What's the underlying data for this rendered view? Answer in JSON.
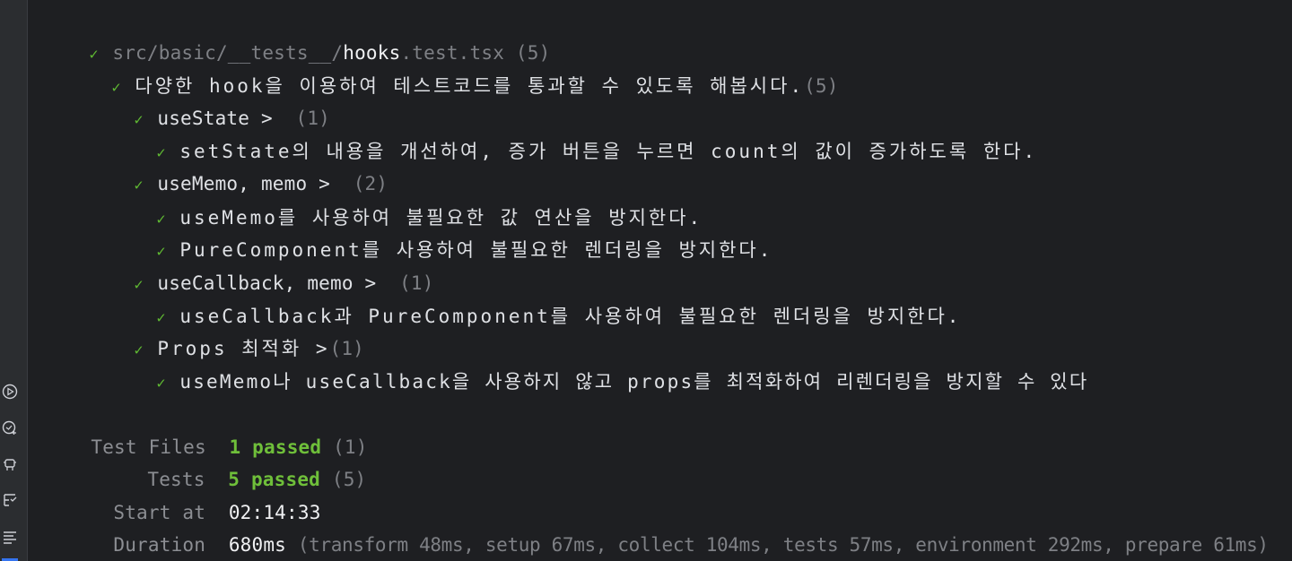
{
  "file": {
    "path_prefix": "src/basic/__tests__/",
    "name": "hooks",
    "ext": ".test.tsx",
    "count": "(5)"
  },
  "suite": {
    "title": "다양한 hook을 이용하여 테스트코드를 통과할 수 있도록 해봅시다.",
    "count": "(5)"
  },
  "groups": [
    {
      "title": "useState >",
      "count": "(1)",
      "tests": [
        "setState의 내용을 개선하여, 증가 버튼을 누르면 count의 값이 증가하도록 한다."
      ]
    },
    {
      "title": "useMemo, memo >",
      "count": "(2)",
      "tests": [
        "useMemo를 사용하여 불필요한 값 연산을 방지한다.",
        "PureComponent를 사용하여 불필요한 렌더링을 방지한다."
      ]
    },
    {
      "title": "useCallback, memo >",
      "count": "(1)",
      "tests": [
        "useCallback과 PureComponent를 사용하여 불필요한 렌더링을 방지한다."
      ]
    },
    {
      "title": "Props 최적화 >",
      "count": "(1)",
      "tests": [
        "useMemo나 useCallback을 사용하지 않고 props를 최적화하여 리렌더링을 방지할 수 있다"
      ]
    }
  ],
  "summary": {
    "test_files_label": "Test Files",
    "test_files_value": "1 passed",
    "test_files_count": "(1)",
    "tests_label": "Tests",
    "tests_value": "5 passed",
    "tests_count": "(5)",
    "start_label": "Start at",
    "start_value": "02:14:33",
    "duration_label": "Duration",
    "duration_value": "680ms",
    "duration_detail": "(transform 48ms, setup 67ms, collect 104ms, tests 57ms, environment 292ms, prepare 61ms)"
  },
  "gutter_icons": [
    "run-icon",
    "coverage-icon",
    "debug-icon",
    "test-tree-icon",
    "format-icon"
  ],
  "check_glyph": "✓",
  "colors": {
    "background": "#1e1f22",
    "pass_green": "#5fb832",
    "dim_text": "#7e8085",
    "text": "#dfe1e5"
  }
}
